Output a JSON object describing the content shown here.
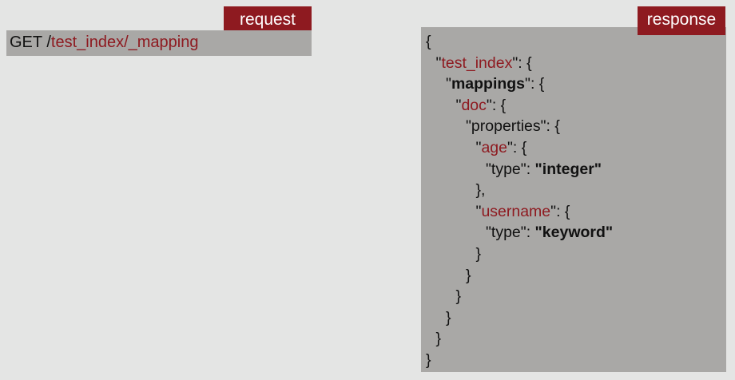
{
  "request": {
    "tag_label": "request",
    "method": "GET",
    "path_separator": "/",
    "path": "test_index/_mapping"
  },
  "response": {
    "tag_label": "response",
    "lines": [
      {
        "indent": 0,
        "parts": [
          {
            "t": "{",
            "c": "plain"
          }
        ]
      },
      {
        "indent": 1,
        "parts": [
          {
            "t": "\"",
            "c": "plain"
          },
          {
            "t": "test_index",
            "c": "red"
          },
          {
            "t": "\": {",
            "c": "plain"
          }
        ]
      },
      {
        "indent": 2,
        "parts": [
          {
            "t": "\"",
            "c": "plain"
          },
          {
            "t": "mappings",
            "c": "bold"
          },
          {
            "t": "\": {",
            "c": "plain"
          }
        ]
      },
      {
        "indent": 3,
        "parts": [
          {
            "t": "\"",
            "c": "plain"
          },
          {
            "t": "doc",
            "c": "red"
          },
          {
            "t": "\": {",
            "c": "plain"
          }
        ]
      },
      {
        "indent": 4,
        "parts": [
          {
            "t": "\"properties\": {",
            "c": "plain"
          }
        ]
      },
      {
        "indent": 5,
        "parts": [
          {
            "t": "\"",
            "c": "plain"
          },
          {
            "t": "age",
            "c": "red"
          },
          {
            "t": "\": {",
            "c": "plain"
          }
        ]
      },
      {
        "indent": 6,
        "parts": [
          {
            "t": "\"type\": ",
            "c": "plain"
          },
          {
            "t": "\"integer\"",
            "c": "bold"
          }
        ]
      },
      {
        "indent": 5,
        "parts": [
          {
            "t": "},",
            "c": "plain"
          }
        ]
      },
      {
        "indent": 5,
        "parts": [
          {
            "t": "\"",
            "c": "plain"
          },
          {
            "t": "username",
            "c": "red"
          },
          {
            "t": "\": {",
            "c": "plain"
          }
        ]
      },
      {
        "indent": 6,
        "parts": [
          {
            "t": "\"type\": ",
            "c": "plain"
          },
          {
            "t": "\"keyword\"",
            "c": "bold"
          }
        ]
      },
      {
        "indent": 5,
        "parts": [
          {
            "t": "}",
            "c": "plain"
          }
        ]
      },
      {
        "indent": 4,
        "parts": [
          {
            "t": "}",
            "c": "plain"
          }
        ]
      },
      {
        "indent": 3,
        "parts": [
          {
            "t": "}",
            "c": "plain"
          }
        ]
      },
      {
        "indent": 2,
        "parts": [
          {
            "t": "}",
            "c": "plain"
          }
        ]
      },
      {
        "indent": 1,
        "parts": [
          {
            "t": "}",
            "c": "plain"
          }
        ]
      },
      {
        "indent": 0,
        "parts": [
          {
            "t": "}",
            "c": "plain"
          }
        ]
      }
    ]
  },
  "colors": {
    "background": "#e4e5e4",
    "panel": "#a9a8a6",
    "accent_red": "#8e1a20"
  }
}
